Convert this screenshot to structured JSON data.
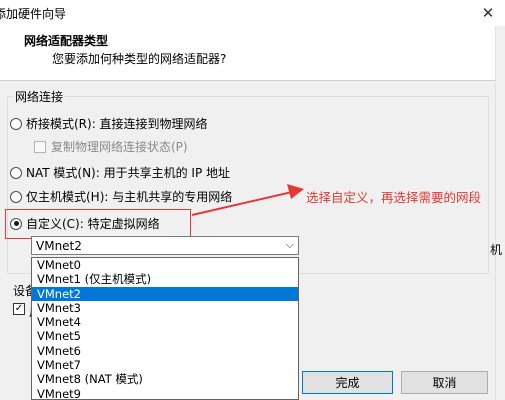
{
  "window": {
    "title": "添加硬件向导",
    "close_icon": "close-icon"
  },
  "header": {
    "title": "网络适配器类型",
    "subtitle": "您要添加何种类型的网络适配器?"
  },
  "connection_group": {
    "label": "网络连接",
    "options": [
      {
        "label": "桥接模式(R): 直接连接到物理网络",
        "checked": false
      },
      {
        "label": "NAT 模式(N): 用于共享主机的 IP 地址",
        "checked": false
      },
      {
        "label": "仅主机模式(H): 与主机共享的专用网络",
        "checked": false
      },
      {
        "label": "自定义(C): 特定虚拟网络",
        "checked": true
      }
    ],
    "replicate_checkbox": {
      "label": "复制物理网络连接状态(P)",
      "checked": false,
      "enabled": false
    }
  },
  "vmnet_combo": {
    "selected": "VMnet2",
    "options": [
      "VMnet0",
      "VMnet1 (仅主机模式)",
      "VMnet2",
      "VMnet3",
      "VMnet4",
      "VMnet5",
      "VMnet6",
      "VMnet7",
      "VMnet8 (NAT 模式)",
      "VMnet9"
    ],
    "selected_index": 2
  },
  "device_section": {
    "label": "设备",
    "checkbox_char": "启",
    "checked": true
  },
  "right_fragment": "机",
  "annotation": {
    "text": "选择自定义，再选择需要的网段",
    "color": "#e53935"
  },
  "buttons": {
    "finish": "完成",
    "cancel": "取消"
  },
  "colors": {
    "accent": "#0078d7",
    "annotation_red": "#e53935"
  }
}
